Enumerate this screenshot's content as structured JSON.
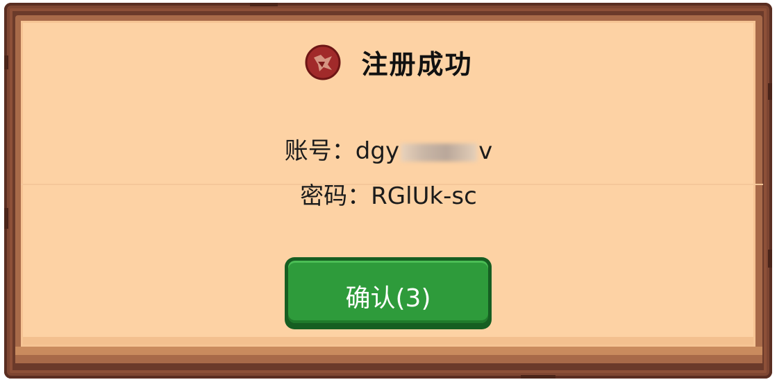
{
  "dialog": {
    "title": "注册成功",
    "logo_icon": "game-emblem-icon",
    "account_label": "账号：",
    "account_value_visible_prefix": "dgy",
    "account_value_visible_suffix": "v",
    "password_label": "密码：",
    "password_value": "RGlUk-sc",
    "confirm_label": "确认(3)"
  },
  "colors": {
    "frame_wood": "#6b3a2a",
    "parchment": "#fdd2a4",
    "button_green": "#2e9b3b",
    "button_dark": "#165e22",
    "text": "#111111"
  }
}
